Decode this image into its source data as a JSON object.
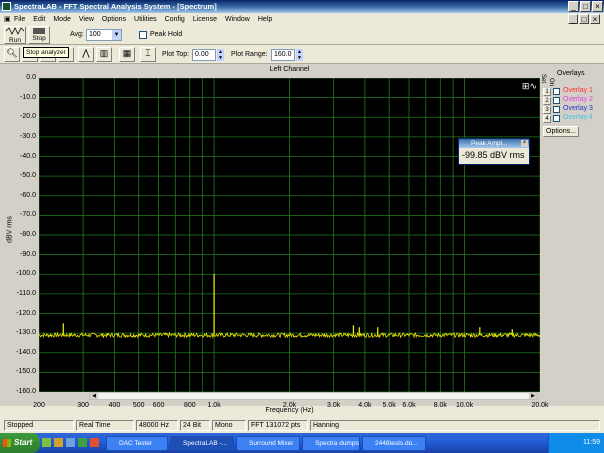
{
  "window": {
    "title": "SpectraLAB - FFT Spectral Analysis System - [Spectrum]"
  },
  "menu": [
    "File",
    "Edit",
    "Mode",
    "View",
    "Options",
    "Utilities",
    "Config",
    "License",
    "Window",
    "Help"
  ],
  "toolbar": {
    "run_label": "Run",
    "stop_label": "Stop",
    "avg_label": "Avg:",
    "avg_value": "100",
    "peak_hold_label": "Peak Hold",
    "tooltip": "Stop analyzer",
    "plot_top_label": "Plot Top:",
    "plot_top_value": "0.00",
    "plot_range_label": "Plot Range:",
    "plot_range_value": "160.0"
  },
  "plot": {
    "channel_title": "Left Channel",
    "ylabel": "dBV rms",
    "xlabel": "Frequency (Hz)",
    "y_ticks": [
      "0.0",
      "-10.0",
      "-20.0",
      "-30.0",
      "-40.0",
      "-50.0",
      "-60.0",
      "-70.0",
      "-80.0",
      "-90.0",
      "-100.0",
      "-110.0",
      "-120.0",
      "-130.0",
      "-140.0",
      "-150.0",
      "-160.0"
    ],
    "x_ticks": [
      {
        "label": "200",
        "f": 200
      },
      {
        "label": "300",
        "f": 300
      },
      {
        "label": "400",
        "f": 400
      },
      {
        "label": "500",
        "f": 500
      },
      {
        "label": "600",
        "f": 600
      },
      {
        "label": "800",
        "f": 800
      },
      {
        "label": "1.0k",
        "f": 1000
      },
      {
        "label": "2.0k",
        "f": 2000
      },
      {
        "label": "3.0k",
        "f": 3000
      },
      {
        "label": "4.0k",
        "f": 4000
      },
      {
        "label": "5.0k",
        "f": 5000
      },
      {
        "label": "6.0k",
        "f": 6000
      },
      {
        "label": "8.0k",
        "f": 8000
      },
      {
        "label": "10.0k",
        "f": 10000
      },
      {
        "label": "20.0k",
        "f": 20000
      }
    ],
    "trace_color": "#e6e600",
    "grid_color": "#1f7a1f"
  },
  "chart_data": {
    "type": "line",
    "xlabel": "Frequency (Hz)",
    "ylabel": "dBV rms",
    "title": "Left Channel",
    "xscale": "log",
    "xlim": [
      200,
      20000
    ],
    "ylim": [
      -160,
      0
    ],
    "grid": true,
    "noise_floor": -131,
    "peaks": [
      {
        "f": 250,
        "y": -125
      },
      {
        "f": 1000,
        "y": -99.85
      },
      {
        "f": 3600,
        "y": -126
      },
      {
        "f": 3800,
        "y": -127
      },
      {
        "f": 4500,
        "y": -127
      },
      {
        "f": 11500,
        "y": -127
      },
      {
        "f": 15500,
        "y": -128
      }
    ]
  },
  "overlays": {
    "title": "Overlays",
    "set_label": "Set",
    "on_label": "On",
    "items": [
      {
        "num": "1",
        "label": "Overlay 1",
        "color": "#ff3030"
      },
      {
        "num": "2",
        "label": "Overlay 2",
        "color": "#e040e0"
      },
      {
        "num": "3",
        "label": "Overlay 3",
        "color": "#2030d0"
      },
      {
        "num": "4",
        "label": "Overlay 4",
        "color": "#40c0e0"
      }
    ],
    "options_label": "Options..."
  },
  "peak_window": {
    "title": "Peak Ampl...",
    "value": "-99.85 dBV rms"
  },
  "status": [
    "Stopped",
    "Real Time",
    "48000 Hz",
    "24 Bit",
    "Mono",
    "FFT 131072 pts",
    "Hanning"
  ],
  "taskbar": {
    "start": "Start",
    "tasks": [
      "DAC Tester",
      "SpectraLAB -...",
      "Surround Mixer",
      "Spectra dumps",
      "2448tests.do..."
    ],
    "clock": "11:59"
  }
}
